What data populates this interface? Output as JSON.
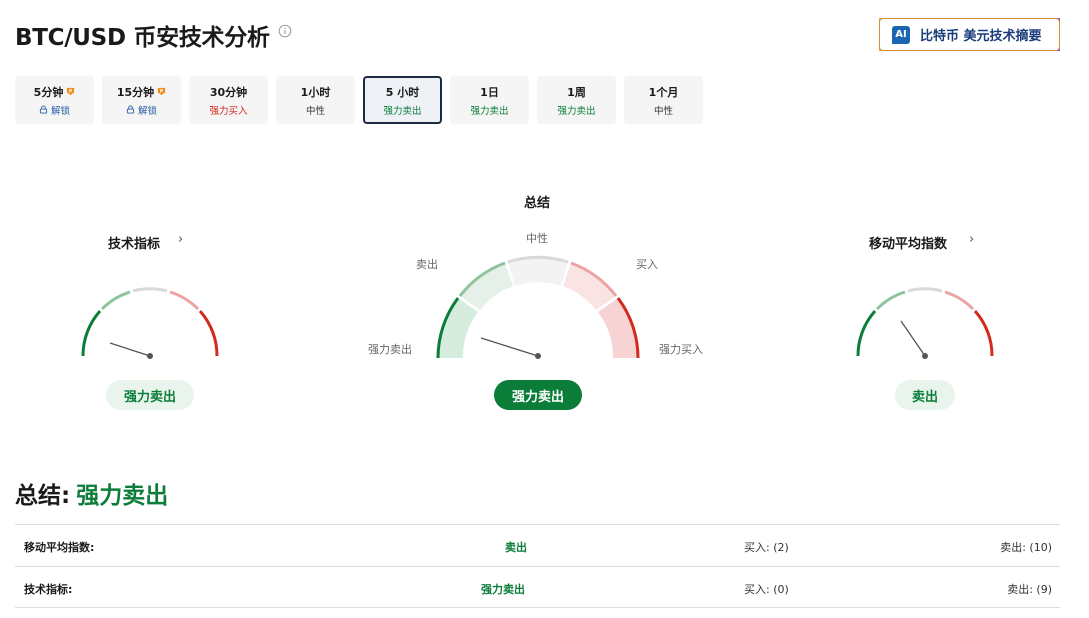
{
  "header": {
    "title": "BTC/USD 币安技术分析",
    "ai_badge": "AI",
    "ai_button": "比特币 美元技术摘要"
  },
  "tabs": [
    {
      "label": "5分钟",
      "sub": "解锁",
      "locked": true
    },
    {
      "label": "15分钟",
      "sub": "解锁",
      "locked": true
    },
    {
      "label": "30分钟",
      "sub": "强力买入"
    },
    {
      "label": "1小时",
      "sub": "中性"
    },
    {
      "label": "5 小时",
      "sub": "强力卖出",
      "selected": true
    },
    {
      "label": "1日",
      "sub": "强力卖出"
    },
    {
      "label": "1周",
      "sub": "强力卖出"
    },
    {
      "label": "1个月",
      "sub": "中性"
    }
  ],
  "gauges": {
    "left": {
      "title": "技术指标",
      "chevron": "›",
      "result": "强力卖出"
    },
    "center": {
      "title": "总结",
      "labels": {
        "neutral": "中性",
        "sell": "卖出",
        "buy": "买入",
        "strong_sell": "强力卖出",
        "strong_buy": "强力买入"
      },
      "result": "强力卖出"
    },
    "right": {
      "title": "移动平均指数",
      "chevron": "›",
      "result": "卖出"
    }
  },
  "summary": {
    "label": "总结:",
    "value": "强力卖出"
  },
  "table": [
    {
      "name": "移动平均指数:",
      "signal": "卖出",
      "buy": "买入: (2)",
      "sell": "卖出: (10)"
    },
    {
      "name": "技术指标:",
      "signal": "强力卖出",
      "buy": "买入: (0)",
      "sell": "卖出: (9)"
    }
  ],
  "colors": {
    "strong_sell": "#0b7d39",
    "sell": "#8dc49e",
    "neutral": "#d9d9d9",
    "buy": "#eba3a3",
    "strong_buy": "#d32a1e"
  }
}
